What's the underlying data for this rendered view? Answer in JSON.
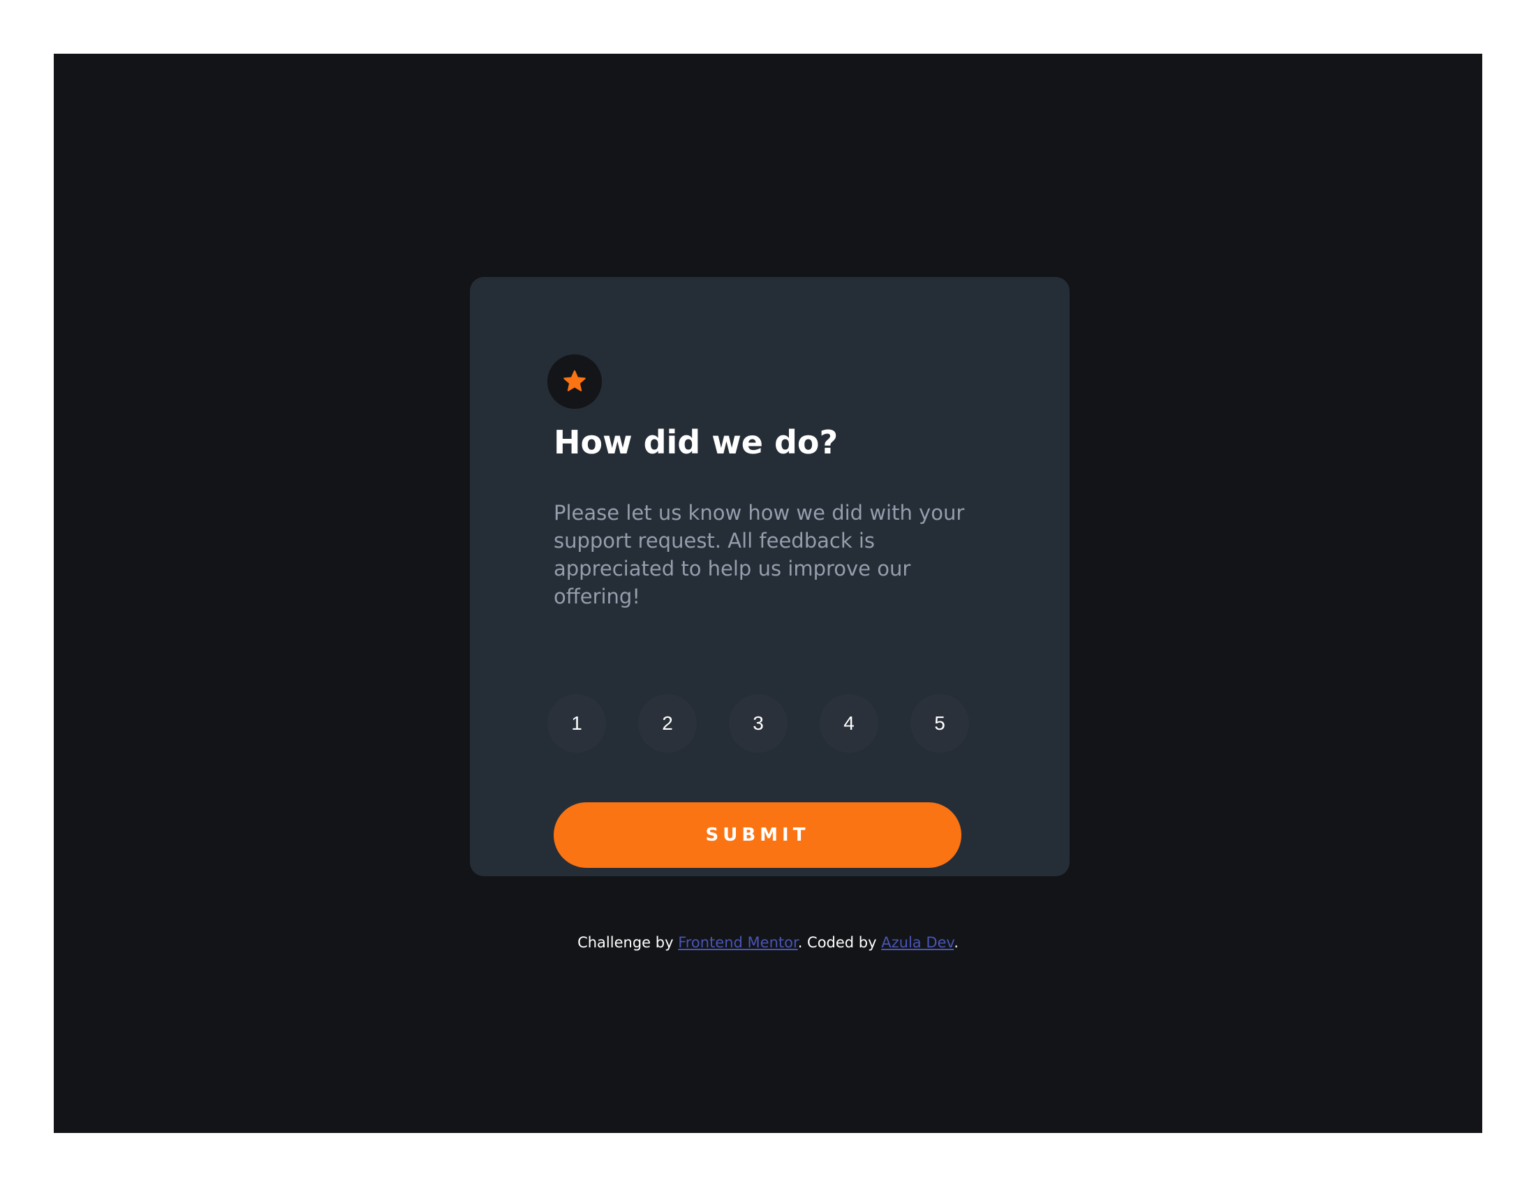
{
  "card": {
    "icon": "star-icon",
    "title": "How did we do?",
    "description": "Please let us know how we did with your support request. All feedback is appreciated to help us improve our offering!",
    "ratings": [
      "1",
      "2",
      "3",
      "4",
      "5"
    ],
    "submit_label": "SUBMIT"
  },
  "attribution": {
    "prefix": "Challenge by ",
    "link1_text": "Frontend Mentor",
    "middle": ". Coded by ",
    "link2_text": "Azula Dev",
    "suffix": "."
  },
  "colors": {
    "page_background": "#121417",
    "card_background": "#252d37",
    "accent": "#fb7413",
    "text_muted": "#959eac",
    "link": "#4a55b5"
  }
}
